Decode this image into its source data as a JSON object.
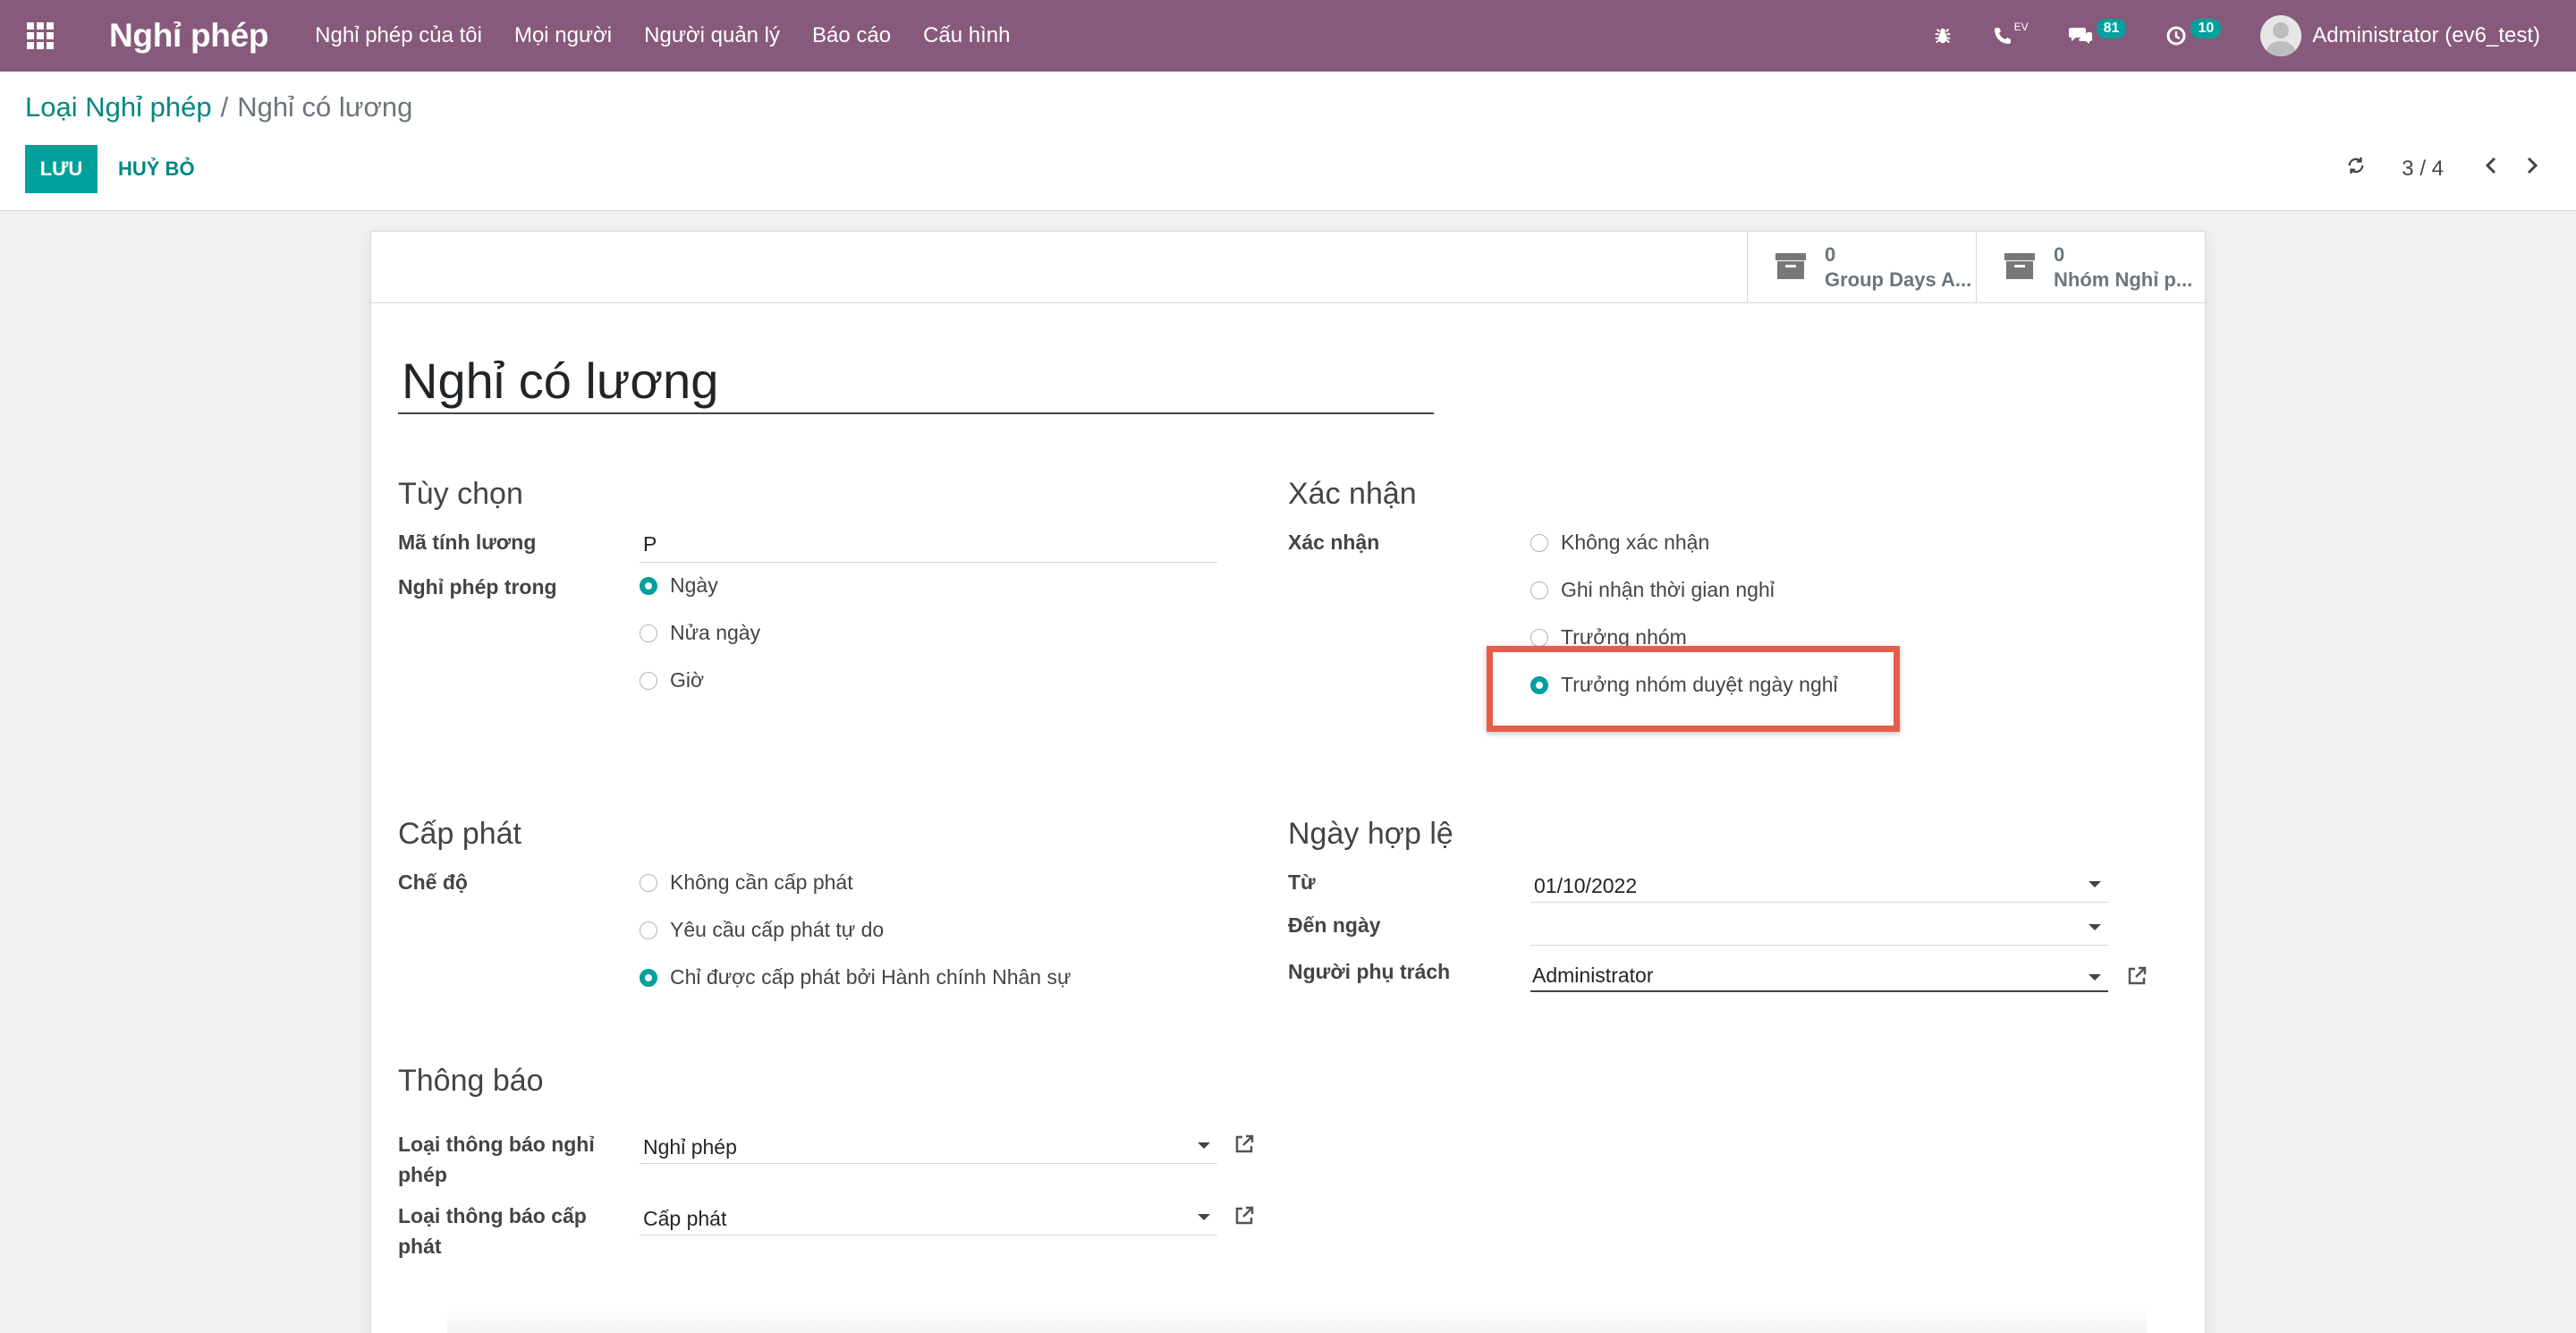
{
  "navbar": {
    "app_title": "Nghỉ phép",
    "menu": [
      "Nghỉ phép của tôi",
      "Mọi người",
      "Người quản lý",
      "Báo cáo",
      "Cấu hình"
    ],
    "call_badge": "EV",
    "messages_count": "81",
    "activities_count": "10",
    "user": "Administrator (ev6_test)",
    "bg_color": "#875a7b"
  },
  "control_panel": {
    "breadcrumb_parent": "Loại Nghỉ phép",
    "breadcrumb_sep": "/",
    "breadcrumb_current": "Nghỉ có lương",
    "save_label": "LƯU",
    "cancel_label": "HUỶ BỎ",
    "pager_value": "3 / 4"
  },
  "stat_buttons": [
    {
      "value": "0",
      "label": "Group Days A..."
    },
    {
      "value": "0",
      "label": "Nhóm Nghỉ p..."
    }
  ],
  "form": {
    "title": "Nghỉ có lương",
    "options": {
      "heading": "Tùy chọn",
      "payroll_code_label": "Mã tính lương",
      "payroll_code_value": "P",
      "leave_in_label": "Nghỉ phép trong",
      "leave_in_options": [
        "Ngày",
        "Nửa ngày",
        "Giờ"
      ],
      "leave_in_selected": 0
    },
    "validation": {
      "heading": "Xác nhận",
      "validation_label": "Xác nhận",
      "validation_options": [
        "Không xác nhận",
        "Ghi nhận thời gian nghỉ",
        "Trưởng nhóm",
        "Trưởng nhóm duyệt ngày nghỉ"
      ],
      "validation_selected": 3,
      "responsible_label": "Người phụ trách",
      "responsible_value": "Administrator"
    },
    "allocation": {
      "heading": "Cấp phát",
      "mode_label": "Chế độ",
      "mode_options": [
        "Không cần cấp phát",
        "Yêu cầu cấp phát tự do",
        "Chỉ được cấp phát bởi Hành chính Nhân sự"
      ],
      "mode_selected": 2
    },
    "validity": {
      "heading": "Ngày hợp lệ",
      "from_label": "Từ",
      "from_value": "01/10/2022",
      "to_label": "Đến ngày",
      "to_value": ""
    },
    "notification": {
      "heading": "Thông báo",
      "leave_notif_label_1": "Loại thông báo nghỉ",
      "leave_notif_label_2": "phép",
      "leave_notif_value": "Nghỉ phép",
      "alloc_notif_label_1": "Loại thông báo cấp",
      "alloc_notif_label_2": "phát",
      "alloc_notif_value": "Cấp phát"
    }
  },
  "accent_color": "#00a09d",
  "highlight_color": "#e85c4a"
}
